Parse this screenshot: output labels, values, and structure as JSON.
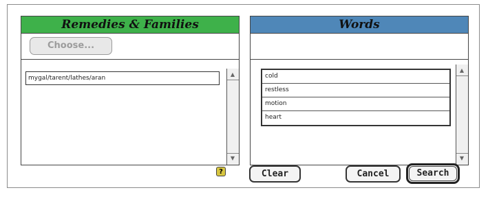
{
  "remedies_panel": {
    "title": "Remedies & Families",
    "choose_label": "Choose...",
    "items": [
      "mygal/tarent/lathes/aran"
    ]
  },
  "words_panel": {
    "title": "Words",
    "items": [
      "cold",
      "restless",
      "motion",
      "heart"
    ]
  },
  "buttons": {
    "clear": "Clear",
    "cancel": "Cancel",
    "search": "Search"
  },
  "icons": {
    "help": "help-icon",
    "scroll_up": "scroll-up-arrow",
    "scroll_down": "scroll-down-arrow"
  },
  "colors": {
    "remedies_header": "#3eb14a",
    "words_header": "#4f87b8"
  }
}
